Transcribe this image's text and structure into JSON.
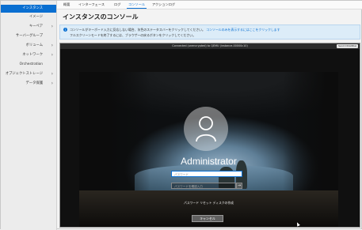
{
  "sidebar": {
    "items": [
      {
        "label": "インスタンス",
        "active": true,
        "chevron": false
      },
      {
        "label": "イメージ",
        "active": false,
        "chevron": false
      },
      {
        "label": "キーペア",
        "active": false,
        "chevron": true
      },
      {
        "label": "サーバーグループ",
        "active": false,
        "chevron": false
      },
      {
        "label": "ボリューム",
        "active": false,
        "chevron": true
      },
      {
        "label": "ネットワーク",
        "active": false,
        "chevron": true
      },
      {
        "label": "Orchestration",
        "active": false,
        "chevron": false
      },
      {
        "label": "オブジェクトストレージ",
        "active": false,
        "chevron": true
      },
      {
        "label": "データ保護",
        "active": false,
        "chevron": true
      }
    ]
  },
  "tabs": [
    "概要",
    "インターフェース",
    "ログ",
    "コンソール",
    "アクションログ"
  ],
  "active_tab": "コンソール",
  "page_title": "インスタンスのコンソール",
  "info": {
    "line1": "コンソールがキーボード入力に反応しない場合、灰色のステータスバーをクリックしてください。",
    "line1_link": "コンソールのみを表示するにはここをクリックします",
    "line2": "フルスクリーンモードを終了するには、ブラウザーの戻るボタンをクリックしてください。"
  },
  "console": {
    "status": "Connected (unencrypted) to QEMU (instance-00000c10)",
    "cad_button": "Send CtrlAltDel"
  },
  "login": {
    "username": "Administrator",
    "pin_placeholder": "パスワード",
    "password_placeholder": "パスワードを確認入力",
    "reset_link": "パスワード リセット ディスクの作成",
    "cancel_button": "キャンセル"
  },
  "colors": {
    "accent": "#0a6fd1",
    "active_sidebar": "#0a6fd1",
    "info_bg": "#dcecf8"
  }
}
